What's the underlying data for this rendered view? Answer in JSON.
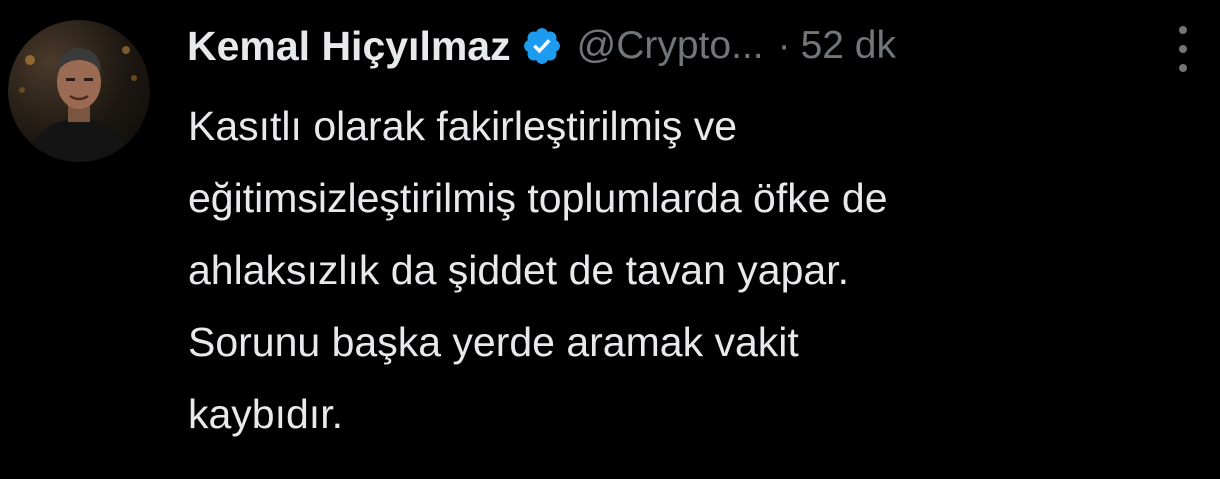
{
  "tweet": {
    "display_name": "Kemal Hiçyılmaz",
    "handle": "@Crypto...",
    "separator": "·",
    "time": "52 dk",
    "verified_icon": "verified-badge-icon",
    "more_icon": "more-vertical-icon",
    "avatar": "profile-photo",
    "text_lines": [
      "Kasıtlı olarak fakirleştirilmiş ve",
      "eğitimsizleştirilmiş toplumlarda öfke de",
      "ahlaksızlık da şiddet de tavan yapar.",
      "Sorunu başka yerde aramak vakit",
      "kaybıdır."
    ]
  },
  "colors": {
    "background": "#000000",
    "primary_text": "#e7e9ea",
    "secondary_text": "#71767b",
    "verified_blue": "#1d9bf0"
  }
}
